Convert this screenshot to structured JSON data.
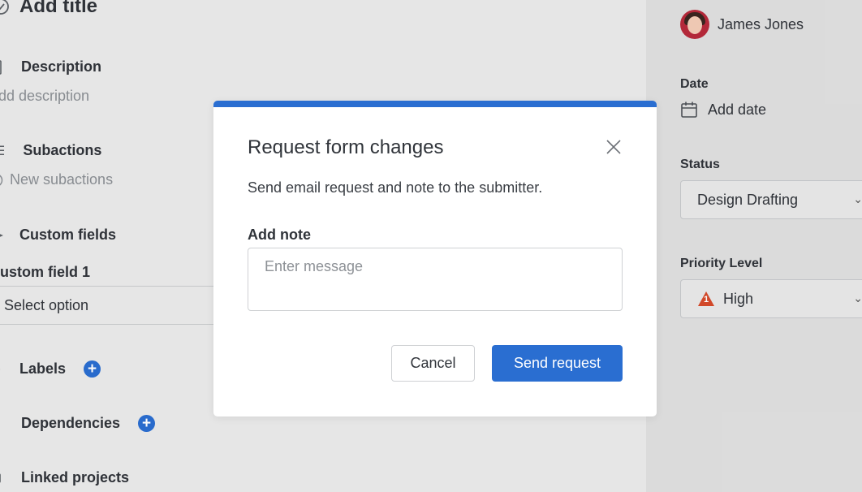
{
  "left": {
    "title": "Add title",
    "description_label": "Description",
    "description_placeholder": "dd description",
    "subactions_label": "Subactions",
    "new_subactions": "New subactions",
    "custom_fields_label": "Custom fields",
    "custom_field_1_label": "ustom field 1",
    "custom_field_1_value": "Select option",
    "labels_label": "Labels",
    "dependencies_label": "Dependencies",
    "linked_projects_label": "Linked projects"
  },
  "right": {
    "assignee_name": "James Jones",
    "date_label": "Date",
    "date_value": "Add date",
    "status_label": "Status",
    "status_value": "Design Drafting",
    "priority_label": "Priority Level",
    "priority_value": "High",
    "priority_badge": "1",
    "priority_color": "#d64a2a"
  },
  "modal": {
    "title": "Request form changes",
    "description": "Send email request and note to the submitter.",
    "note_label": "Add note",
    "note_placeholder": "Enter message",
    "note_value": "",
    "cancel_label": "Cancel",
    "send_label": "Send request",
    "accent_color": "#2a6ed1"
  },
  "icons": {
    "close": "close-icon",
    "calendar": "calendar-icon",
    "plus": "plus-circle-icon",
    "warning": "warning-triangle-icon"
  }
}
